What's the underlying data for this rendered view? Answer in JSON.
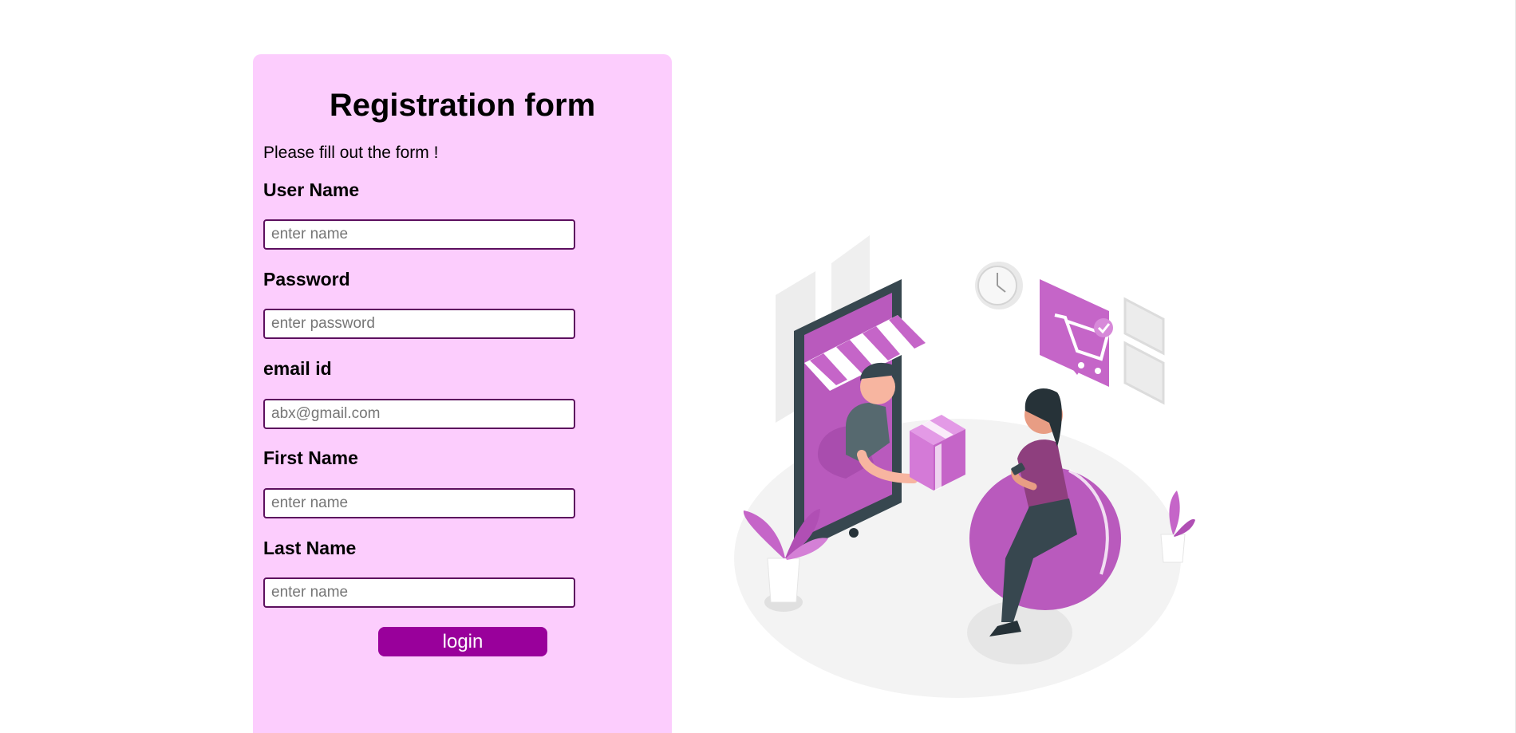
{
  "form": {
    "title": "Registration form",
    "subtitle": "Please fill out the form !",
    "fields": [
      {
        "label": "User Name",
        "placeholder": "enter name",
        "type": "text"
      },
      {
        "label": "Password",
        "placeholder": "enter password",
        "type": "password"
      },
      {
        "label": "email id",
        "placeholder": "abx@gmail.com",
        "type": "email"
      },
      {
        "label": "First Name",
        "placeholder": "enter name",
        "type": "text"
      },
      {
        "label": "Last Name",
        "placeholder": "enter name",
        "type": "text"
      }
    ],
    "submit_label": "login"
  },
  "colors": {
    "page_background": "#ffffff",
    "panel_background": "#fccdfd",
    "input_border": "#5c0f5e",
    "button_background": "#99009b",
    "button_text": "#ffffff",
    "illustration_accent": "#c565c8"
  },
  "illustration": {
    "icon": "online-shopping-delivery-illustration"
  }
}
